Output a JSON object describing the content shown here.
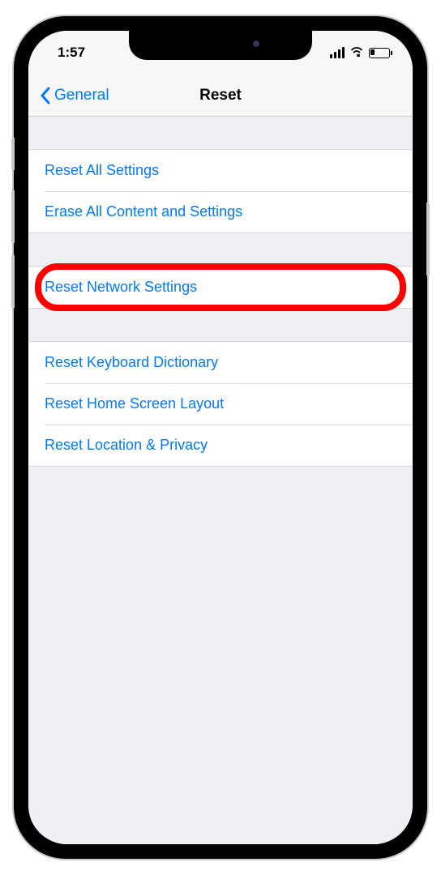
{
  "status": {
    "time": "1:57"
  },
  "nav": {
    "back_label": "General",
    "title": "Reset"
  },
  "groups": [
    {
      "items": [
        {
          "label": "Reset All Settings",
          "name": "reset-all-settings"
        },
        {
          "label": "Erase All Content and Settings",
          "name": "erase-all-content-and-settings"
        }
      ]
    },
    {
      "items": [
        {
          "label": "Reset Network Settings",
          "name": "reset-network-settings",
          "highlighted": true
        }
      ]
    },
    {
      "items": [
        {
          "label": "Reset Keyboard Dictionary",
          "name": "reset-keyboard-dictionary"
        },
        {
          "label": "Reset Home Screen Layout",
          "name": "reset-home-screen-layout"
        },
        {
          "label": "Reset Location & Privacy",
          "name": "reset-location-and-privacy"
        }
      ]
    }
  ],
  "annotation": {
    "highlight_color": "#ff0000"
  }
}
